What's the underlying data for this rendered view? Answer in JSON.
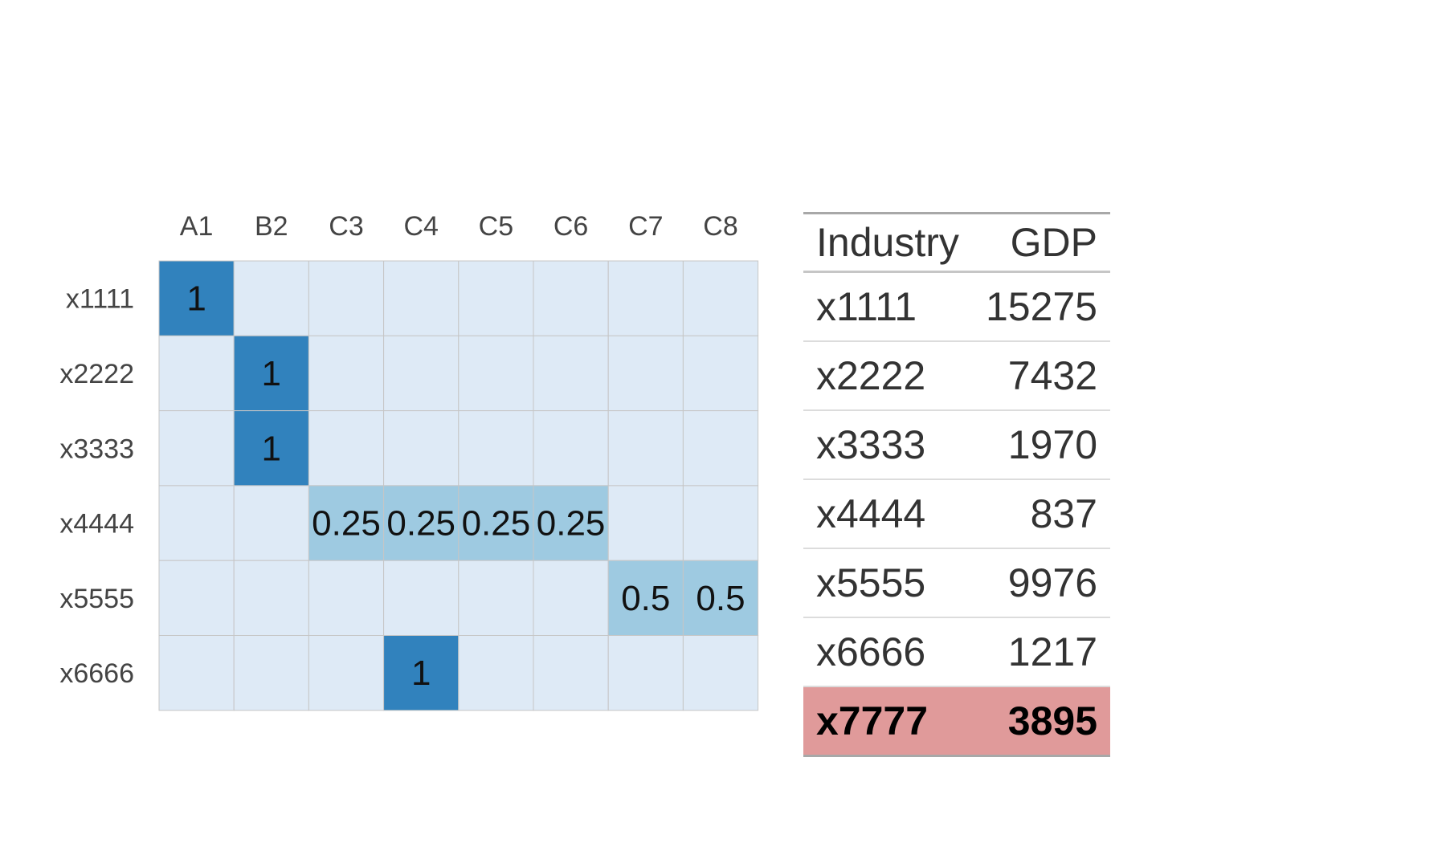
{
  "chart_data": [
    {
      "type": "heatmap",
      "title": "",
      "xlabel": "",
      "ylabel": "",
      "x": [
        "A1",
        "B2",
        "C3",
        "C4",
        "C5",
        "C6",
        "C7",
        "C8"
      ],
      "y": [
        "x1111",
        "x2222",
        "x3333",
        "x4444",
        "x5555",
        "x6666"
      ],
      "values": [
        [
          1,
          null,
          null,
          null,
          null,
          null,
          null,
          null
        ],
        [
          null,
          1,
          null,
          null,
          null,
          null,
          null,
          null
        ],
        [
          null,
          1,
          null,
          null,
          null,
          null,
          null,
          null
        ],
        [
          null,
          null,
          0.25,
          0.25,
          0.25,
          0.25,
          null,
          null
        ],
        [
          null,
          null,
          null,
          null,
          null,
          null,
          0.5,
          0.5
        ],
        [
          null,
          null,
          null,
          1,
          null,
          null,
          null,
          null
        ]
      ],
      "colors": {
        "empty": "#deeaf6",
        "low": "#9ecae1",
        "high": "#3182bd",
        "gridline": "#c6c6c6",
        "label": "#444444",
        "cell_text": "#111111"
      },
      "grid": true,
      "legend": "none"
    },
    {
      "type": "table",
      "columns": [
        "Industry",
        "GDP"
      ],
      "rows": [
        [
          "x1111",
          "15275"
        ],
        [
          "x2222",
          "7432"
        ],
        [
          "x3333",
          "1970"
        ],
        [
          "x4444",
          "837"
        ],
        [
          "x5555",
          "9976"
        ],
        [
          "x6666",
          "1217"
        ],
        [
          "x7777",
          "3895"
        ]
      ],
      "highlight_row": 6,
      "highlight_color": "#e09a9a"
    }
  ]
}
